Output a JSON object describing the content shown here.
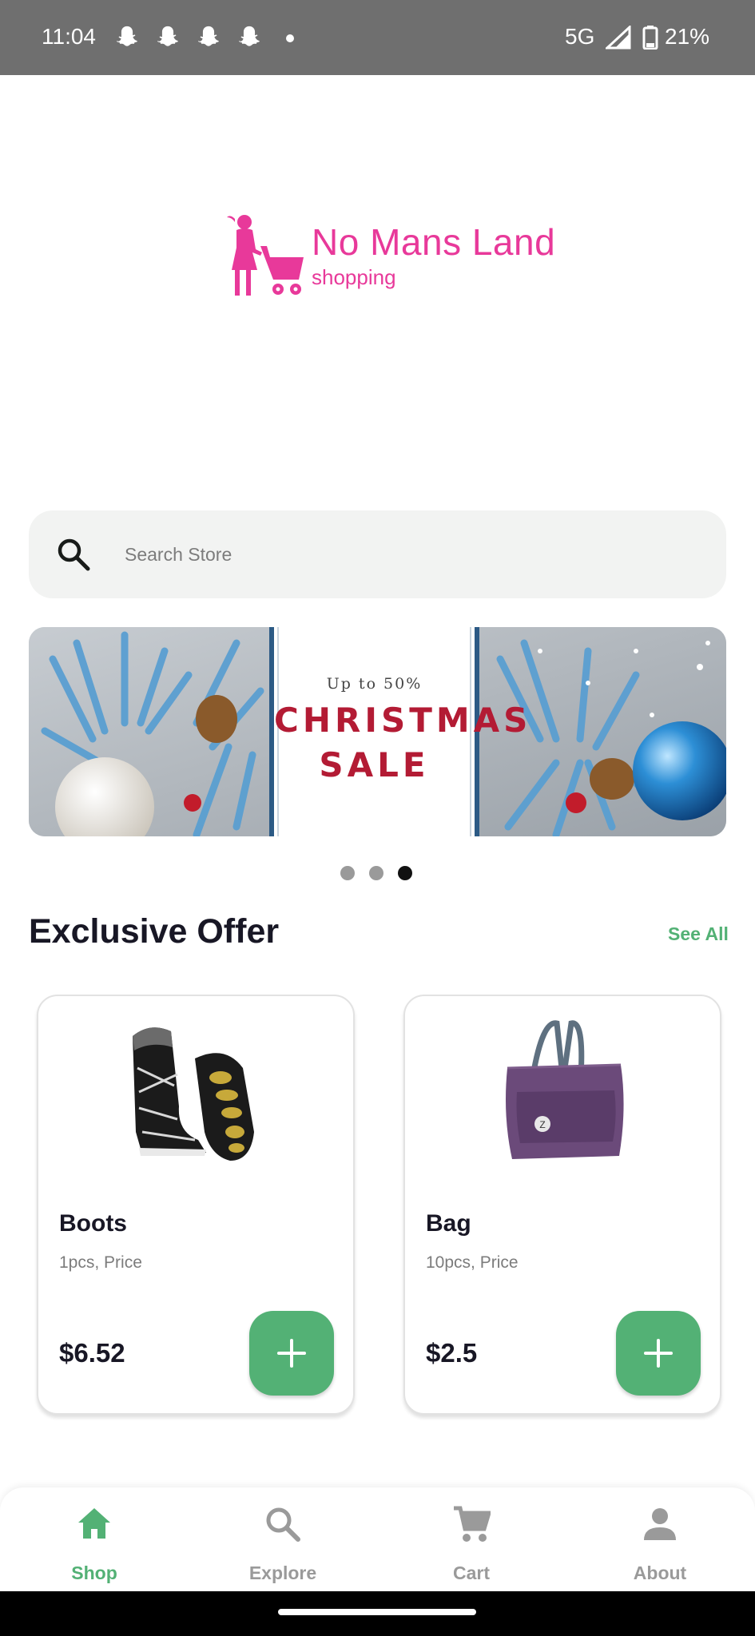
{
  "status_bar": {
    "time": "11:04",
    "network": "5G",
    "battery_percent": "21%",
    "notification_icons": [
      "snapchat-icon",
      "snapchat-icon",
      "snapchat-icon",
      "snapchat-icon"
    ]
  },
  "logo": {
    "brand": "No Mans Land",
    "tagline": "shopping",
    "color": "#e8399a"
  },
  "search": {
    "placeholder": "Search Store",
    "value": ""
  },
  "banner": {
    "line_small": "Up to 50%",
    "line_1": "CHRISTMAS",
    "line_2": "SALE",
    "page_count": 3,
    "active_page": 3
  },
  "section": {
    "title": "Exclusive Offer",
    "see_all": "See All"
  },
  "products": [
    {
      "name": "Boots",
      "quantity": "1pcs, Price",
      "price": "$6.52",
      "image": "boots-image"
    },
    {
      "name": "Bag",
      "quantity": "10pcs, Price",
      "price": "$2.5",
      "image": "bag-image"
    }
  ],
  "bottom_nav": [
    {
      "label": "Shop",
      "icon": "home-icon",
      "active": true
    },
    {
      "label": "Explore",
      "icon": "search-icon",
      "active": false
    },
    {
      "label": "Cart",
      "icon": "cart-icon",
      "active": false
    },
    {
      "label": "About",
      "icon": "person-icon",
      "active": false
    }
  ],
  "colors": {
    "accent": "#53b175",
    "text_dark": "#181725",
    "text_muted": "#7c7c7c",
    "inactive": "#9a9a9a",
    "promo_red": "#b31b34"
  }
}
